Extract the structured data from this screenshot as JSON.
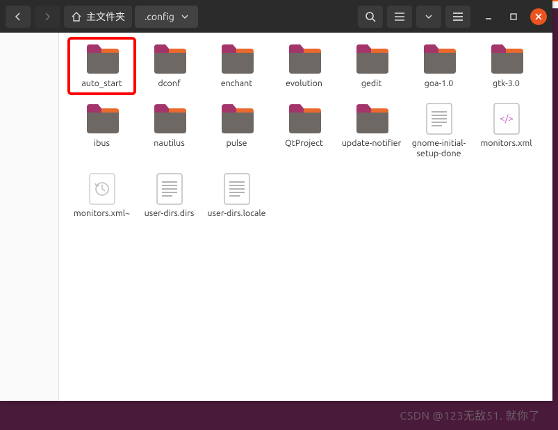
{
  "breadcrumb": {
    "home_label": "主文件夹",
    "current_path": ".config"
  },
  "items": [
    {
      "name": "auto_start",
      "type": "folder",
      "highlight": true
    },
    {
      "name": "dconf",
      "type": "folder"
    },
    {
      "name": "enchant",
      "type": "folder"
    },
    {
      "name": "evolution",
      "type": "folder"
    },
    {
      "name": "gedit",
      "type": "folder"
    },
    {
      "name": "goa-1.0",
      "type": "folder"
    },
    {
      "name": "gtk-3.0",
      "type": "folder"
    },
    {
      "name": "ibus",
      "type": "folder"
    },
    {
      "name": "nautilus",
      "type": "folder"
    },
    {
      "name": "pulse",
      "type": "folder"
    },
    {
      "name": "QtProject",
      "type": "folder"
    },
    {
      "name": "update-notifier",
      "type": "folder"
    },
    {
      "name": "gnome-initial-setup-done",
      "type": "text"
    },
    {
      "name": "monitors.xml",
      "type": "xml"
    },
    {
      "name": "monitors.xml~",
      "type": "backup"
    },
    {
      "name": "user-dirs.dirs",
      "type": "text"
    },
    {
      "name": "user-dirs.locale",
      "type": "text"
    }
  ],
  "watermark": "CSDN @123无敌51. 就你了"
}
